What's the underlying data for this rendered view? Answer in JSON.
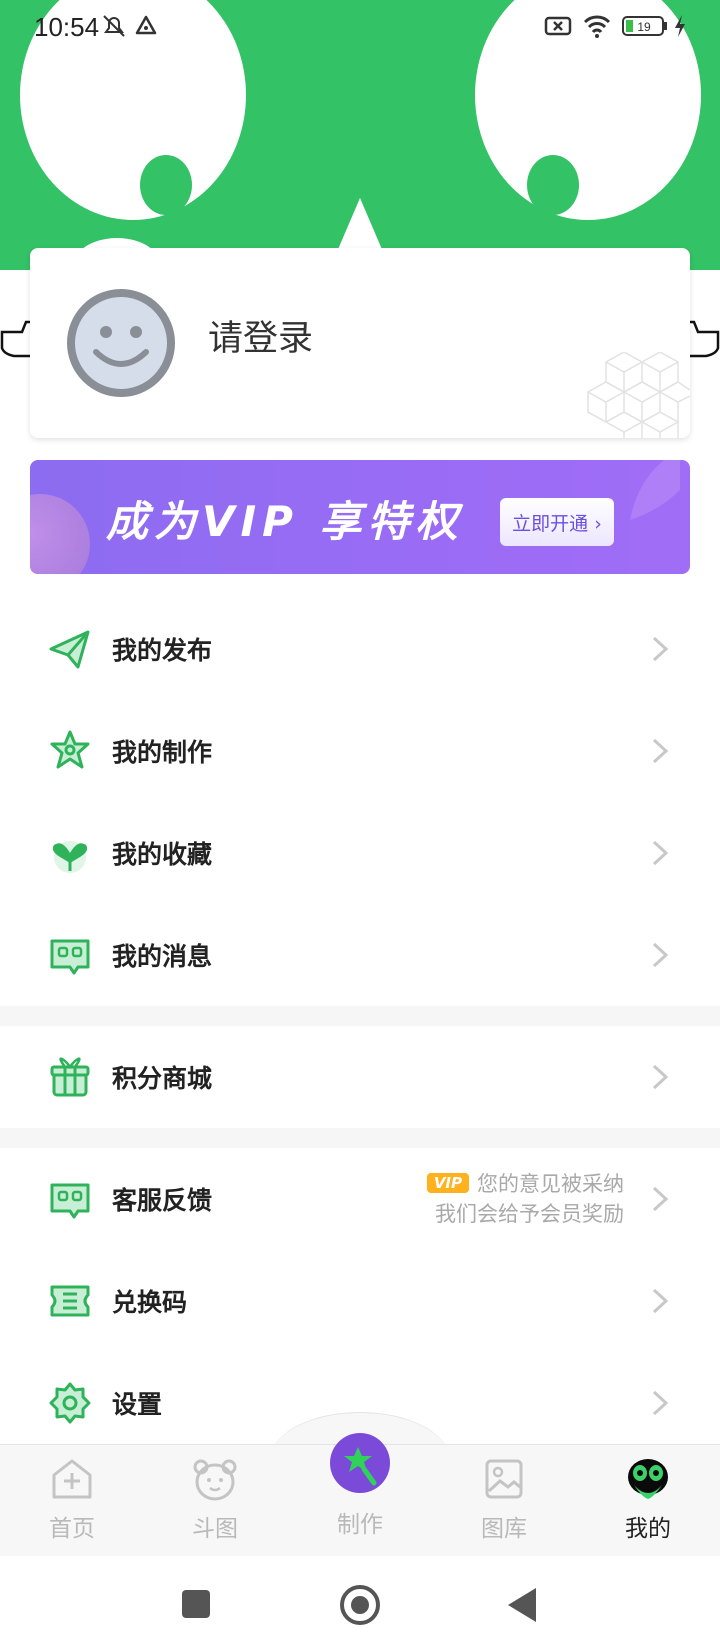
{
  "status_bar": {
    "time": "10:54",
    "battery": "19"
  },
  "profile": {
    "login_prompt": "请登录"
  },
  "vip_banner": {
    "title": "成为VIP 享特权",
    "button": "立即开通 ›"
  },
  "menu_group_1": [
    {
      "label": "我的发布",
      "icon": "paper-plane-icon"
    },
    {
      "label": "我的制作",
      "icon": "star-badge-icon"
    },
    {
      "label": "我的收藏",
      "icon": "heart-icon"
    },
    {
      "label": "我的消息",
      "icon": "message-icon"
    }
  ],
  "menu_group_2": [
    {
      "label": "积分商城",
      "icon": "gift-icon"
    }
  ],
  "menu_group_3": [
    {
      "label": "客服反馈",
      "icon": "feedback-icon",
      "hint_tag": "VIP",
      "hint_line1": "您的意见被采纳",
      "hint_line2": "我们会给予会员奖励"
    },
    {
      "label": "兑换码",
      "icon": "ticket-icon"
    },
    {
      "label": "设置",
      "icon": "gear-icon"
    }
  ],
  "tabbar": {
    "tabs": [
      {
        "label": "首页",
        "icon": "home-plus-icon",
        "active": false
      },
      {
        "label": "斗图",
        "icon": "bear-icon",
        "active": false
      },
      {
        "label": "制作",
        "icon": "magic-wand-icon",
        "active": false
      },
      {
        "label": "图库",
        "icon": "gallery-icon",
        "active": false
      },
      {
        "label": "我的",
        "icon": "alien-face-icon",
        "active": true
      }
    ]
  },
  "colors": {
    "brand_green": "#33c266",
    "vip_purple": "#9a6cf5",
    "tag_orange": "#ffb21e"
  }
}
